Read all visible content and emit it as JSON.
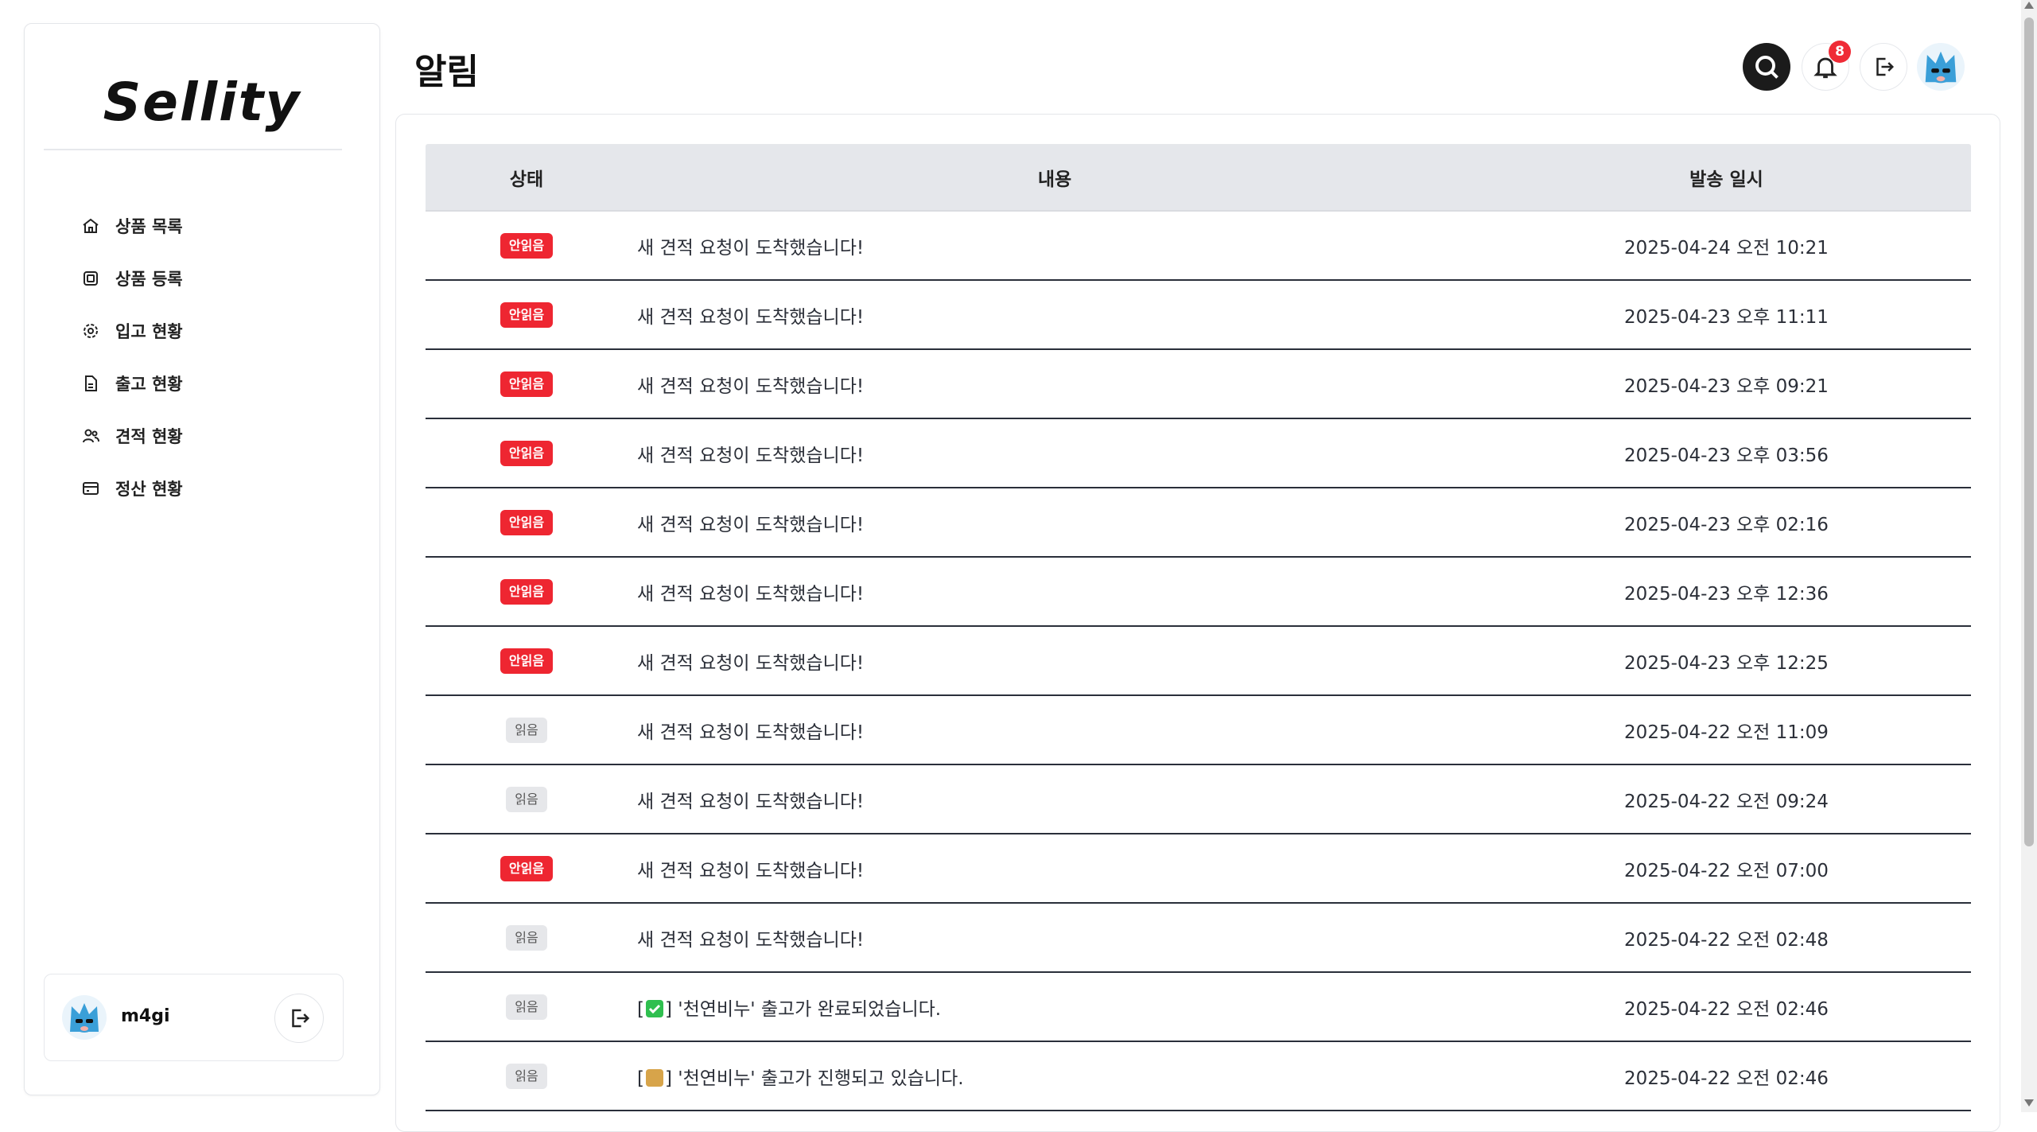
{
  "app": {
    "logo": "Sellity"
  },
  "sidebar": {
    "items": [
      {
        "label": "상품 목록",
        "icon": "home-icon"
      },
      {
        "label": "상품 등록",
        "icon": "cube-icon"
      },
      {
        "label": "입고 현황",
        "icon": "gear-icon"
      },
      {
        "label": "출고 현황",
        "icon": "document-icon"
      },
      {
        "label": "견적 현황",
        "icon": "users-icon"
      },
      {
        "label": "정산 현황",
        "icon": "card-icon"
      }
    ],
    "user": {
      "name": "m4gi",
      "avatar": "cat-avatar-icon",
      "logout_icon": "logout-icon"
    }
  },
  "header": {
    "title": "알림",
    "notification_count": "8",
    "icons": [
      "search-icon",
      "bell-icon",
      "logout-icon",
      "cat-avatar-icon"
    ]
  },
  "table": {
    "headers": {
      "status": "상태",
      "content": "내용",
      "date": "발송 일시"
    },
    "rows": [
      {
        "status": "안읽음",
        "unread": true,
        "content": "새 견적 요청이 도착했습니다!",
        "date": "2025-04-24 오전 10:21"
      },
      {
        "status": "안읽음",
        "unread": true,
        "content": "새 견적 요청이 도착했습니다!",
        "date": "2025-04-23 오후 11:11"
      },
      {
        "status": "안읽음",
        "unread": true,
        "content": "새 견적 요청이 도착했습니다!",
        "date": "2025-04-23 오후 09:21"
      },
      {
        "status": "안읽음",
        "unread": true,
        "content": "새 견적 요청이 도착했습니다!",
        "date": "2025-04-23 오후 03:56"
      },
      {
        "status": "안읽음",
        "unread": true,
        "content": "새 견적 요청이 도착했습니다!",
        "date": "2025-04-23 오후 02:16"
      },
      {
        "status": "안읽음",
        "unread": true,
        "content": "새 견적 요청이 도착했습니다!",
        "date": "2025-04-23 오후 12:36"
      },
      {
        "status": "안읽음",
        "unread": true,
        "content": "새 견적 요청이 도착했습니다!",
        "date": "2025-04-23 오후 12:25"
      },
      {
        "status": "읽음",
        "unread": false,
        "content": "새 견적 요청이 도착했습니다!",
        "date": "2025-04-22 오전 11:09"
      },
      {
        "status": "읽음",
        "unread": false,
        "content": "새 견적 요청이 도착했습니다!",
        "date": "2025-04-22 오전 09:24"
      },
      {
        "status": "안읽음",
        "unread": true,
        "content": "새 견적 요청이 도착했습니다!",
        "date": "2025-04-22 오전 07:00"
      },
      {
        "status": "읽음",
        "unread": false,
        "content": "새 견적 요청이 도착했습니다!",
        "date": "2025-04-22 오전 02:48"
      },
      {
        "status": "읽음",
        "unread": false,
        "emoji": "check-emoji-icon",
        "content_prefix": "[",
        "content_suffix": "] '천연비누' 출고가 완료되었습니다.",
        "date": "2025-04-22 오전 02:46"
      },
      {
        "status": "읽음",
        "unread": false,
        "emoji": "package-emoji-icon",
        "content_prefix": "[",
        "content_suffix": "] '천연비누' 출고가 진행되고 있습니다.",
        "date": "2025-04-22 오전 02:46"
      }
    ]
  },
  "colors": {
    "unread_badge": "#ee2631",
    "read_badge": "#e6e7ea",
    "header_bg": "#e5e7eb",
    "notification_badge": "#ef2b36"
  }
}
